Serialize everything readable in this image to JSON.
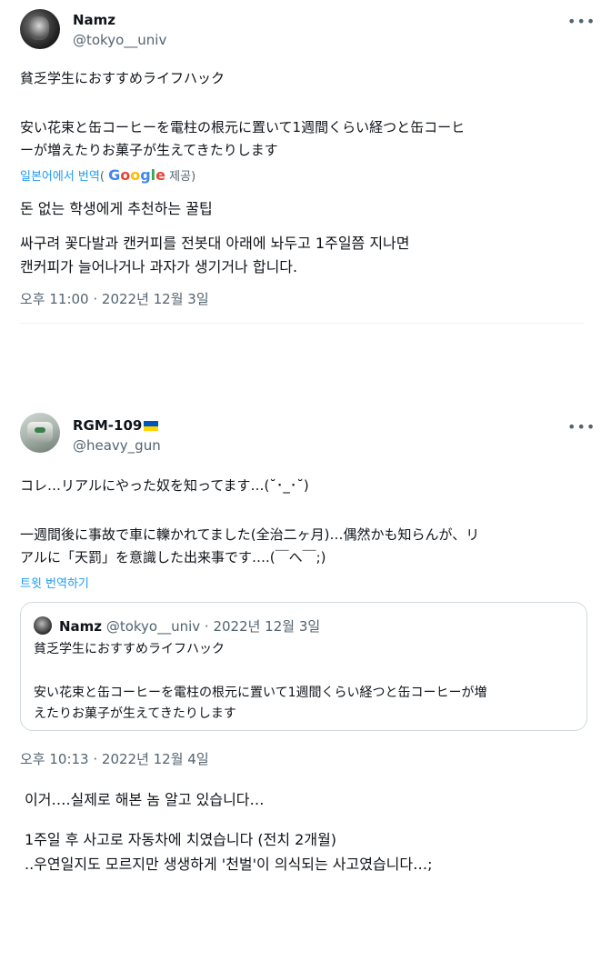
{
  "tweet1": {
    "author_name": "Namz",
    "author_handle": "@tokyo__univ",
    "more_icon": "more-horizontal-icon",
    "line1": "貧乏学生におすすめライフハック",
    "line2": "安い花束と缶コーヒーを電柱の根元に置いて1週間くらい経つと缶コーヒ",
    "line3": "ーが増えたりお菓子が生えてきたりします",
    "translate_prefix": "일본어에서 번역",
    "translate_paren_open": "( ",
    "google_letters": [
      "G",
      "o",
      "o",
      "g",
      "l",
      "e"
    ],
    "translate_suffix": " 제공)",
    "ko_line1": "돈 없는 학생에게 추천하는 꿀팁",
    "ko_line2": "싸구려 꽃다발과 캔커피를 전봇대 아래에 놔두고 1주일쯤 지나면",
    "ko_line3": "캔커피가 늘어나거나 과자가 생기거나 합니다.",
    "timestamp": "오후 11:00 · 2022년 12월 3일"
  },
  "tweet2": {
    "author_name": "RGM-109",
    "author_handle": "@heavy_gun",
    "flag_icon": "ukraine-flag-icon",
    "line1": "コレ…リアルにやった奴を知ってます…(˘･_･˘)",
    "line2": "一週間後に事故で車に轢かれてました(全治二ヶ月)…偶然かも知らんが、リ",
    "line3": "アルに「天罰」を意識した出来事です….(￣へ￣;)",
    "translate_link": "트윗 번역하기",
    "quote": {
      "author_name": "Namz",
      "author_meta": " @tokyo__univ · 2022년 12월 3일",
      "line1": "貧乏学生におすすめライフハック",
      "line2": "安い花束と缶コーヒーを電柱の根元に置いて1週間くらい経つと缶コーヒーが増",
      "line3": "えたりお菓子が生えてきたりします"
    },
    "timestamp": "오후 10:13 · 2022년 12월 4일"
  },
  "translation": {
    "line1": "이거….실제로 해본 놈 알고 있습니다…",
    "line2": "1주일 후 사고로 자동차에 치였습니다 (전치 2개월)",
    "line3": "..우연일지도 모르지만 생생하게 '천벌'이 의식되는 사고였습니다…;"
  }
}
